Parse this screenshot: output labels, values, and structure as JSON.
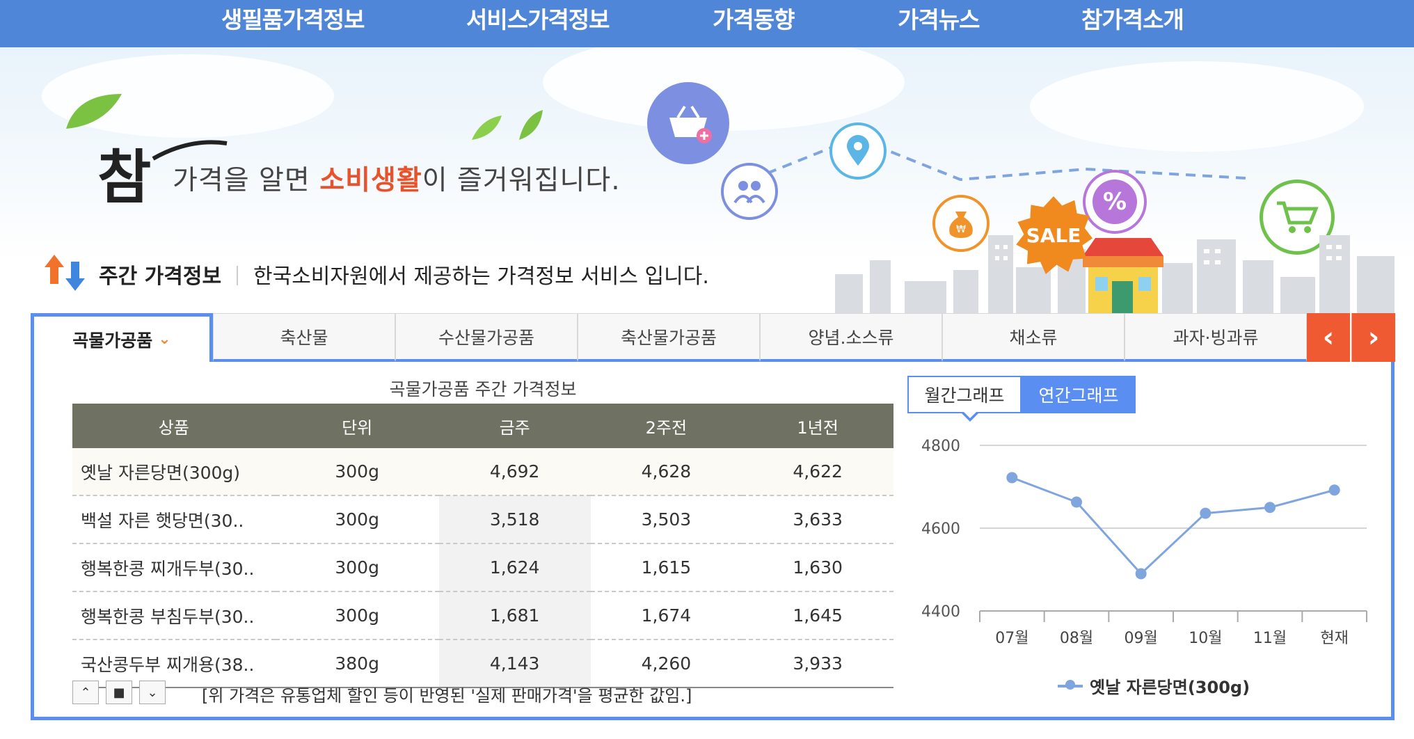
{
  "nav": [
    "생필품가격정보",
    "서비스가격정보",
    "가격동향",
    "가격뉴스",
    "참가격소개"
  ],
  "banner": {
    "logo_text": "참",
    "slogan_pre": "가격을 알면 ",
    "slogan_hl": "소비생활",
    "slogan_post": "이 즐거워집니다.",
    "sale_text": "SALE",
    "icons": [
      "basket-plus-icon",
      "people-icon",
      "location-pin-icon",
      "money-bag-icon",
      "percent-icon",
      "shopping-cart-icon"
    ]
  },
  "weekly": {
    "title": "주간 가격정보",
    "desc": "한국소비자원에서 제공하는 가격정보 서비스 입니다."
  },
  "tabs": [
    "곡물가공품",
    "축산물",
    "수산물가공품",
    "축산물가공품",
    "양념.소스류",
    "채소류",
    "과자·빙과류"
  ],
  "active_tab_chevron": "⌄",
  "arrows": {
    "prev": "‹",
    "next": "›"
  },
  "table": {
    "caption": "곡물가공품 주간 가격정보",
    "headers": [
      "상품",
      "단위",
      "금주",
      "2주전",
      "1년전"
    ],
    "rows": [
      [
        "옛날 자른당면(300g)",
        "300g",
        "4,692",
        "4,628",
        "4,622"
      ],
      [
        "백설 자른 햇당면(30..",
        "300g",
        "3,518",
        "3,503",
        "3,633"
      ],
      [
        "행복한콩 찌개두부(30..",
        "300g",
        "1,624",
        "1,615",
        "1,630"
      ],
      [
        "행복한콩 부침두부(30..",
        "300g",
        "1,681",
        "1,674",
        "1,645"
      ],
      [
        "국산콩두부 찌개용(38..",
        "380g",
        "4,143",
        "4,260",
        "3,933"
      ]
    ]
  },
  "controls": {
    "up": "⌃",
    "stop": "■",
    "down": "⌄"
  },
  "note": "[위 가격은 유통업체 할인 등이 반영된 '실제 판매가격'을 평균한 값임.]",
  "graph_tabs": {
    "month": "월간그래프",
    "year": "연간그래프"
  },
  "chart_data": {
    "type": "line",
    "categories": [
      "07월",
      "08월",
      "09월",
      "10월",
      "11월",
      "현재"
    ],
    "series": [
      {
        "name": "옛날 자른당면(300g)",
        "values": [
          4722,
          4663,
          4490,
          4636,
          4650,
          4692
        ]
      }
    ],
    "ylim": [
      4400,
      4800
    ],
    "yticks": [
      4800,
      4600,
      4400
    ],
    "grid": true,
    "legend": "bottom",
    "color": "#7fa5df"
  }
}
